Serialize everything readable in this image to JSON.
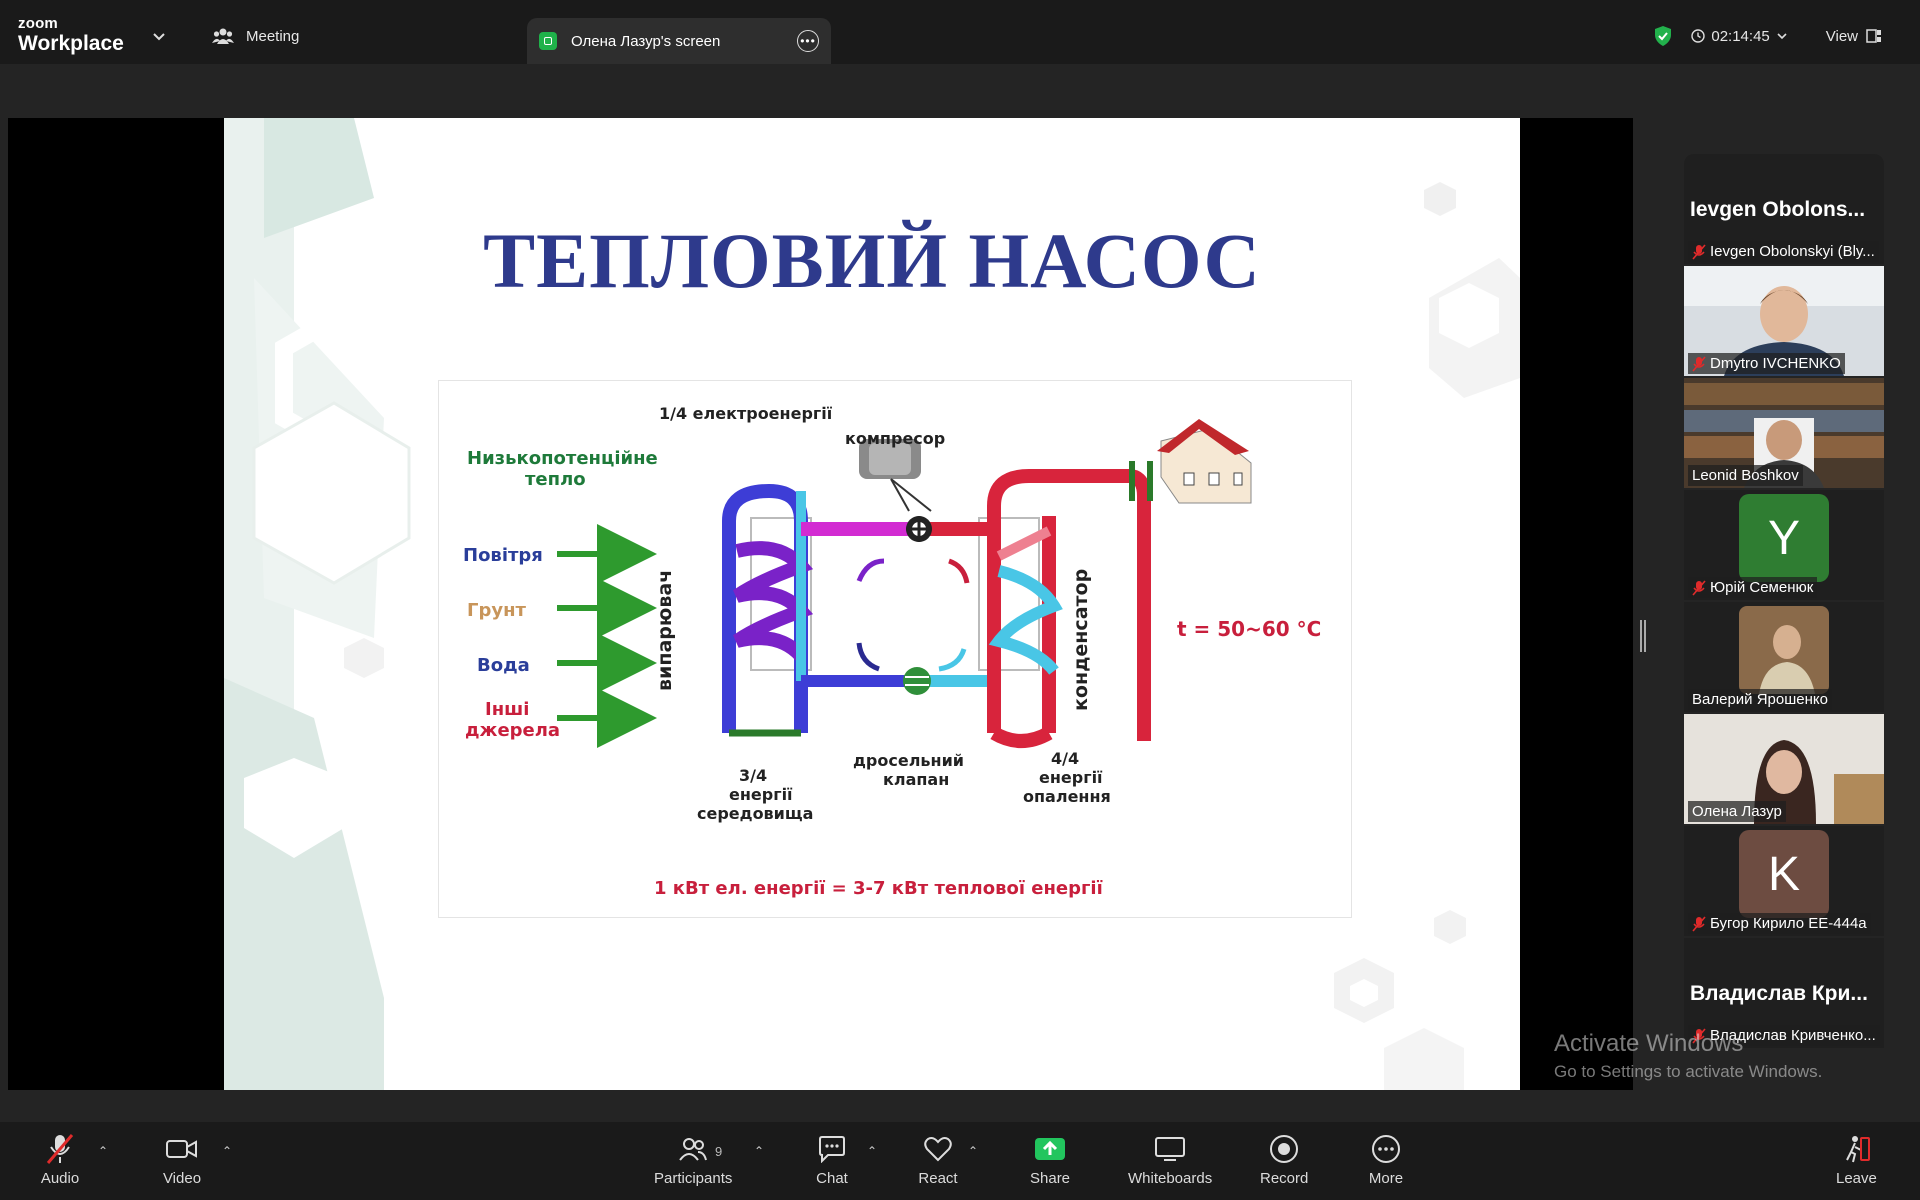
{
  "topbar": {
    "brand_line1": "zoom",
    "brand_line2": "Workplace",
    "meeting_label": "Meeting",
    "screen_tab_label": "Олена Лазур's screen",
    "timer": "02:14:45",
    "view_label": "View"
  },
  "slide": {
    "title": "ТЕПЛОВИЙ НАСОС",
    "electric_label": "1/4 електроенергії",
    "compressor_label": "компресор",
    "low_heat_line1": "Низькопотенційне",
    "low_heat_line2": "тепло",
    "sources": [
      "Повітря",
      "Грунт",
      "Вода",
      "Інші",
      "джерела"
    ],
    "evaporator_label": "випарювач",
    "condenser_label": "конденсатор",
    "temp_label": "t = 50~60 °C",
    "env_line1": "3/4",
    "env_line2": "енергії",
    "env_line3": "середовища",
    "valve_line1": "дросельний",
    "valve_line2": "клапан",
    "heat_line1": "4/4",
    "heat_line2": "енергії",
    "heat_line3": "опалення",
    "bottom_formula": "1 кВт ел. енергії = 3-7 кВт теплової енергії"
  },
  "participants": [
    {
      "big_name": "Ievgen  Obolons...",
      "label": "Ievgen Obolonskyi (Bly...",
      "muted": true
    },
    {
      "label": "Dmytro IVCHENKO",
      "muted": true
    },
    {
      "label": "Leonid Boshkov",
      "muted": false
    },
    {
      "initial": "Y",
      "label": "Юрій Семенюк",
      "muted": true,
      "color": "#2f7d32"
    },
    {
      "label": "Валерий Ярошенко",
      "muted": false
    },
    {
      "label": "Олена Лазур",
      "muted": false,
      "active": true
    },
    {
      "initial": "K",
      "label": "Бугор Кирило ЕЕ-444а",
      "muted": true,
      "color": "#6d4c41"
    },
    {
      "big_name": "Владислав  Кри...",
      "label": "Владислав Кривченко...",
      "muted": true
    }
  ],
  "watermark": {
    "line1": "Activate Windows",
    "line2": "Go to Settings to activate Windows."
  },
  "toolbar": {
    "audio": "Audio",
    "video": "Video",
    "participants": "Participants",
    "participants_count": "9",
    "chat": "Chat",
    "react": "React",
    "share": "Share",
    "whiteboards": "Whiteboards",
    "record": "Record",
    "more": "More",
    "leave": "Leave"
  }
}
